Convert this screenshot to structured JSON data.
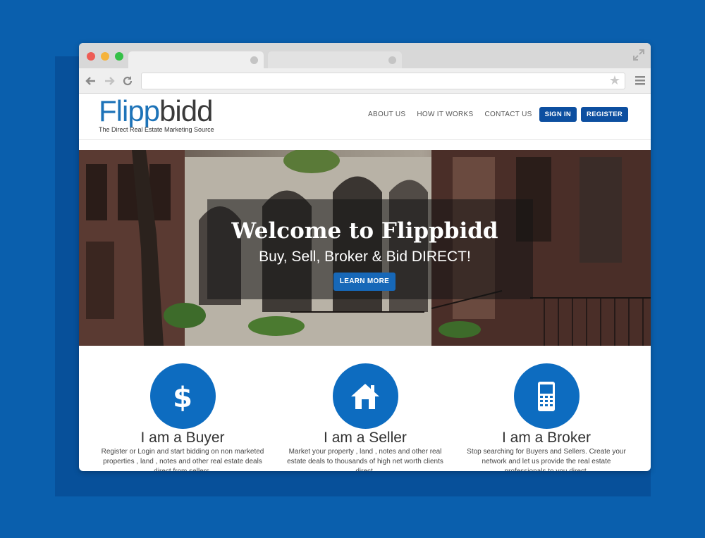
{
  "brand": {
    "logo_part1": "Flipp",
    "logo_part2": "bidd",
    "tagline": "The Direct Real Estate Marketing Source"
  },
  "nav": {
    "about": "ABOUT US",
    "how": "HOW IT WORKS",
    "contact": "CONTACT US",
    "signin": "SIGN IN",
    "register": "REGISTER"
  },
  "hero": {
    "title": "Welcome to Flippbidd",
    "subtitle": "Buy, Sell, Broker & Bid DIRECT!",
    "cta": "LEARN MORE"
  },
  "features": [
    {
      "icon": "dollar-icon",
      "title": "I am a Buyer",
      "text": "Register or Login and start bidding on non marketed properties , land , notes and other real estate deals direct from sellers."
    },
    {
      "icon": "house-icon",
      "title": "I am a Seller",
      "text": "Market your property , land , notes and other real estate deals to thousands of high net worth clients direct."
    },
    {
      "icon": "phone-icon",
      "title": "I am a Broker",
      "text": "Stop searching for Buyers and Sellers. Create your network and let us provide the real estate professionals to you direct."
    }
  ],
  "colors": {
    "background": "#0a5fad",
    "brand_blue": "#1d73b8",
    "button_blue": "#0d4fa0",
    "icon_circle": "#0d6cc0"
  }
}
